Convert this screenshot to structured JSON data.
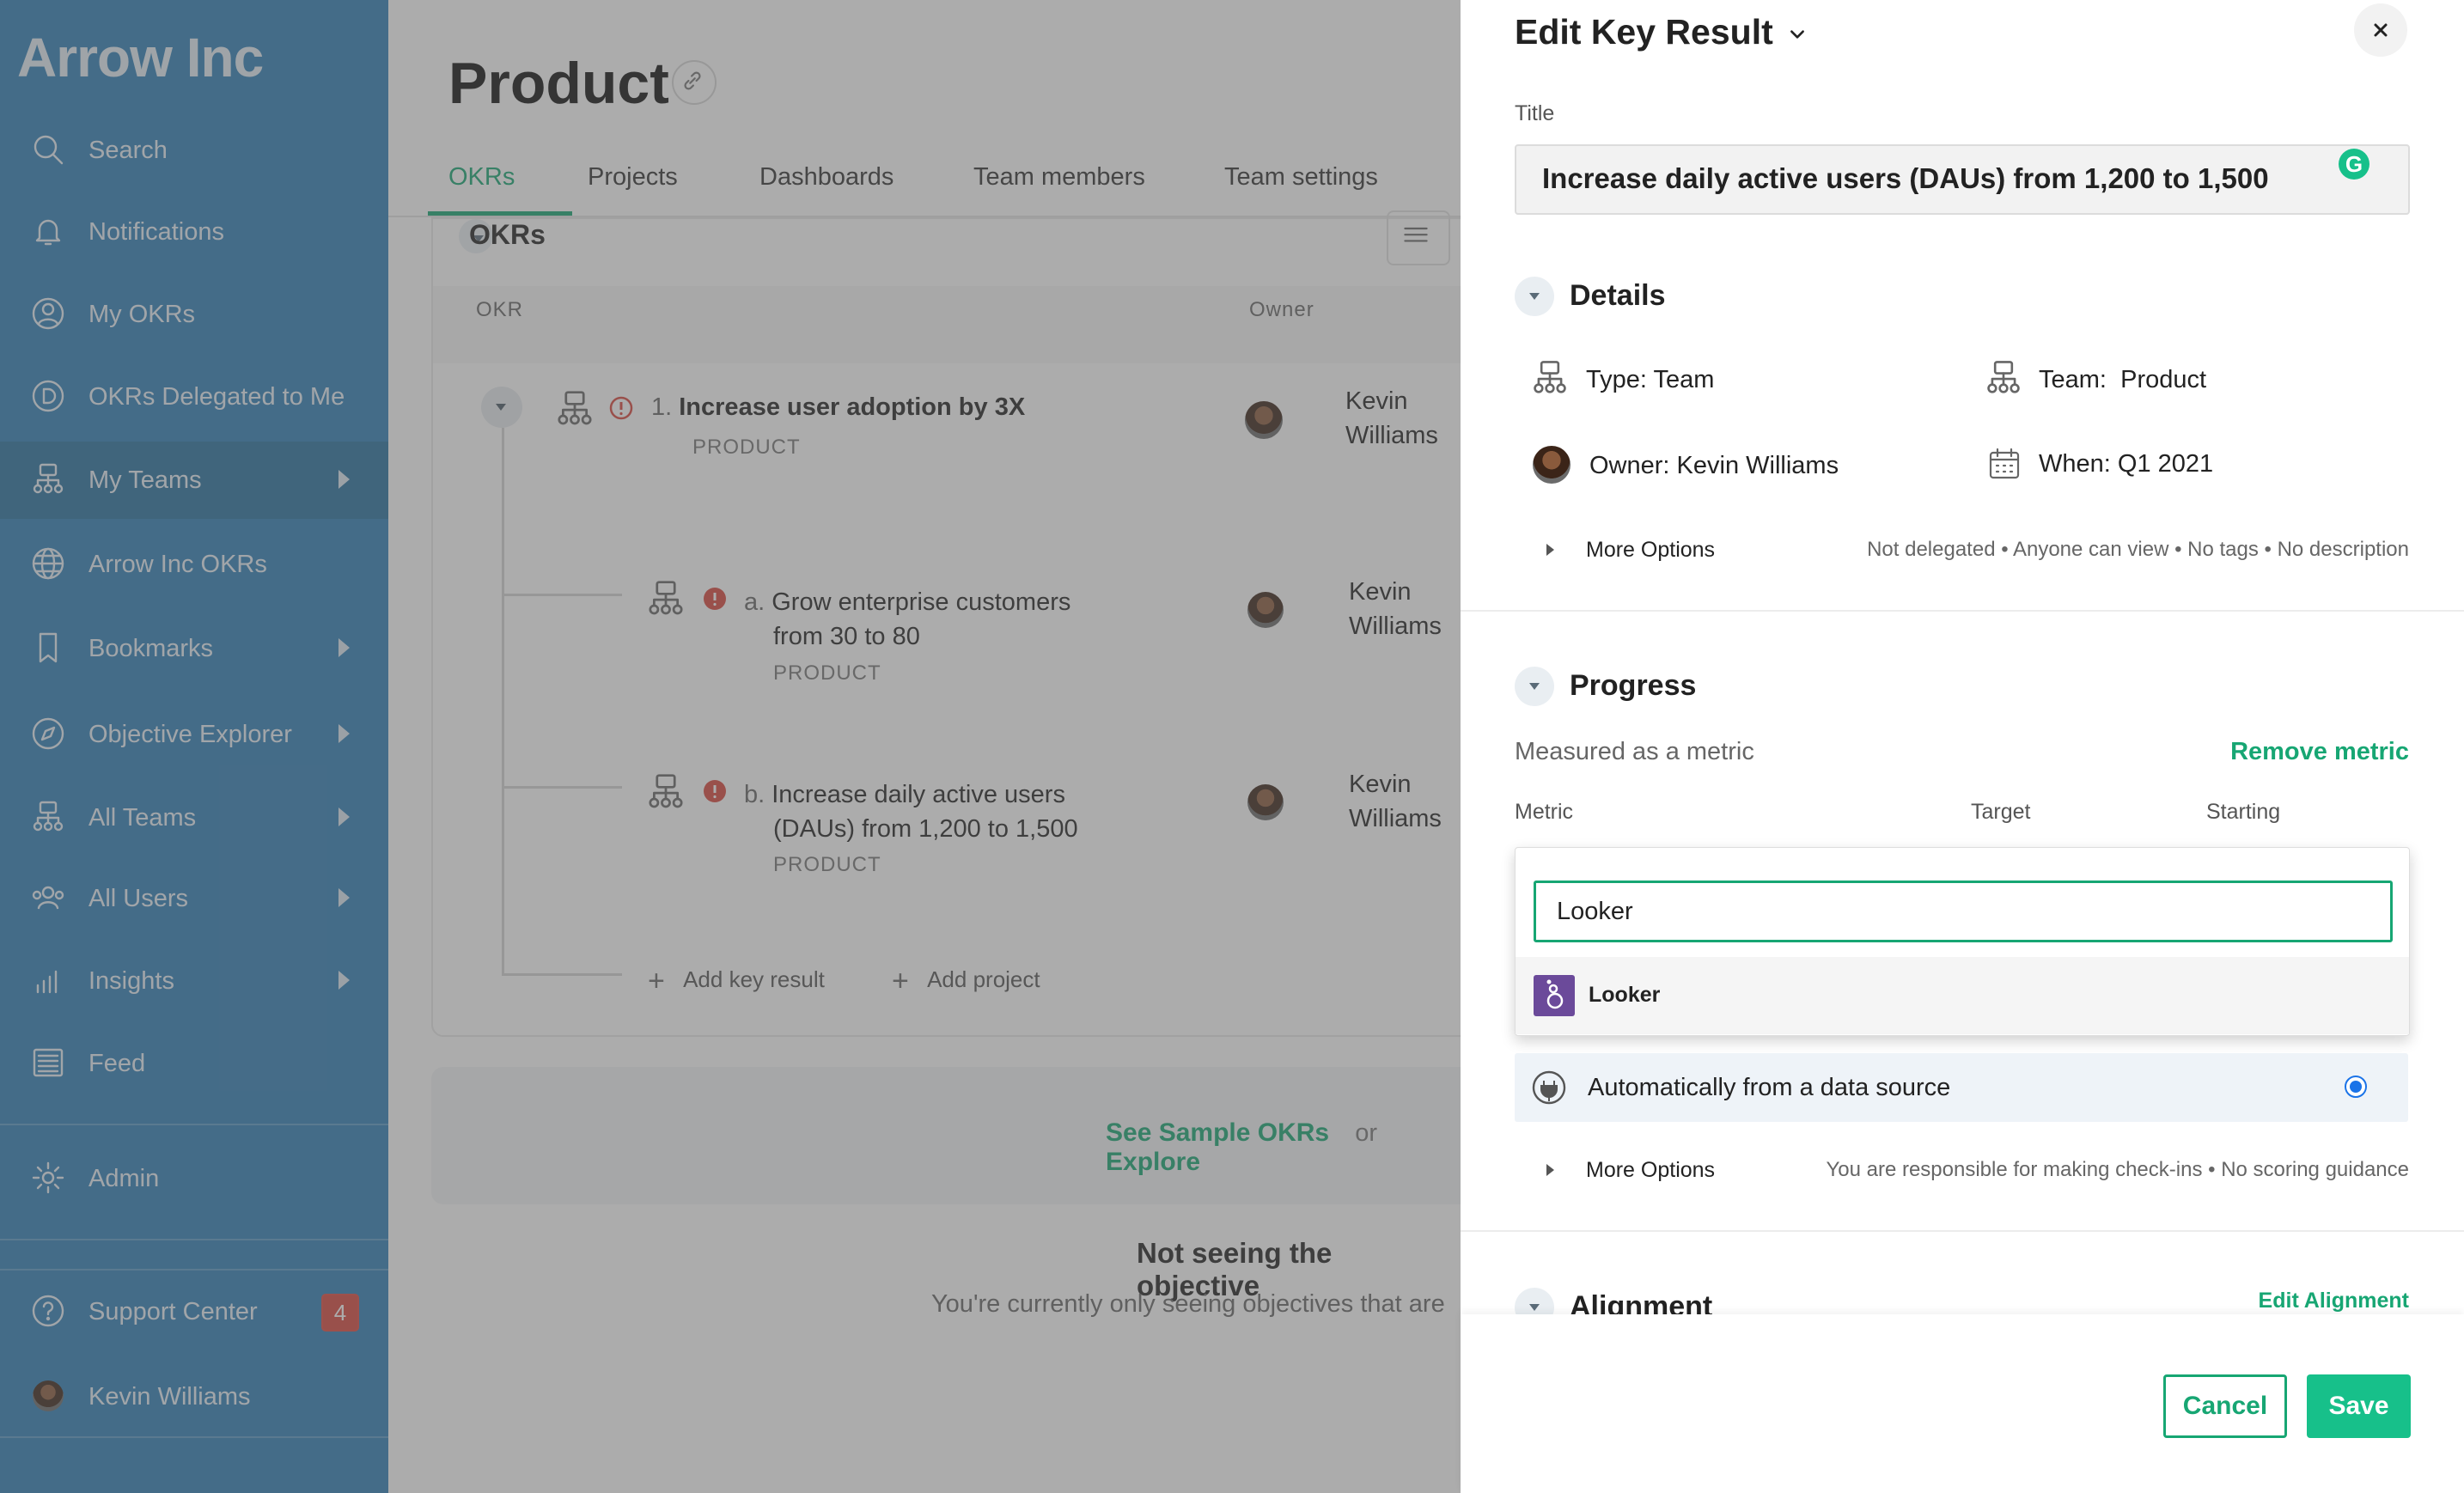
{
  "sidebar": {
    "brand": "Arrow Inc",
    "items": [
      {
        "label": "Search",
        "icon": "search-icon"
      },
      {
        "label": "Notifications",
        "icon": "bell-icon"
      },
      {
        "label": "My OKRs",
        "icon": "user-circle-icon"
      },
      {
        "label": "OKRs Delegated to Me",
        "icon": "delegate-icon"
      },
      {
        "label": "My Teams",
        "icon": "team-icon"
      },
      {
        "label": "Arrow Inc OKRs",
        "icon": "globe-icon"
      },
      {
        "label": "Bookmarks",
        "icon": "bookmark-icon"
      },
      {
        "label": "Objective Explorer",
        "icon": "compass-icon"
      },
      {
        "label": "All Teams",
        "icon": "team-icon"
      },
      {
        "label": "All Users",
        "icon": "users-icon"
      },
      {
        "label": "Insights",
        "icon": "bar-chart-icon"
      },
      {
        "label": "Feed",
        "icon": "feed-icon"
      },
      {
        "label": "Admin",
        "icon": "gear-icon"
      },
      {
        "label": "Support Center",
        "icon": "help-icon"
      },
      {
        "label": "Kevin Williams",
        "icon": "avatar"
      }
    ],
    "support_badge": "4"
  },
  "main": {
    "title": "Product",
    "tabs": [
      "OKRs",
      "Projects",
      "Dashboards",
      "Team members",
      "Team settings"
    ],
    "section_title": "OKRs",
    "col_okr": "OKR",
    "col_owner": "Owner",
    "objective": {
      "num": "1.",
      "title": "Increase user adoption by 3X",
      "team": "PRODUCT",
      "owner_first": "Kevin",
      "owner_last": "Williams"
    },
    "key_results": [
      {
        "letter": "a.",
        "line1": "Grow enterprise customers",
        "line2": "from 30 to 80",
        "team": "PRODUCT",
        "owner_first": "Kevin",
        "owner_last": "Williams"
      },
      {
        "letter": "b.",
        "line1": "Increase daily active users",
        "line2": "(DAUs) from 1,200 to 1,500",
        "team": "PRODUCT",
        "owner_first": "Kevin",
        "owner_last": "Williams"
      }
    ],
    "add_key_result": "Add key result",
    "add_project": "Add project",
    "see_sample": "See Sample OKRs",
    "or": "or",
    "explore": "Explore",
    "not_seeing": "Not seeing the objective",
    "currently": "You're currently only seeing objectives that are"
  },
  "panel": {
    "heading": "Edit Key Result",
    "title_label": "Title",
    "title_value": "Increase daily active users (DAUs) from 1,200 to 1,500",
    "details_heading": "Details",
    "type_label": "Type:",
    "type_value": "Team",
    "team_label": "Team:",
    "team_value": "Product",
    "owner_label": "Owner:",
    "owner_value": "Kevin Williams",
    "when_label": "When:",
    "when_value": "Q1 2021",
    "more_options": "More Options",
    "details_summary": "Not delegated • Anyone can view • No tags • No description",
    "progress_heading": "Progress",
    "measured": "Measured as a metric",
    "remove_metric": "Remove metric",
    "metric_label": "Metric",
    "target_label": "Target",
    "starting_label": "Starting",
    "search_value": "Looker",
    "option_looker": "Looker",
    "auto_label": "Automatically from a data source",
    "progress_summary": "You are responsible for making check-ins • No scoring guidance",
    "alignment_heading": "Alignment",
    "edit_alignment": "Edit Alignment",
    "cancel": "Cancel",
    "save": "Save"
  },
  "colors": {
    "sidebar": "#2f7fb6",
    "accent": "#17a673",
    "danger": "#d9473d",
    "radio": "#1a73e8"
  }
}
